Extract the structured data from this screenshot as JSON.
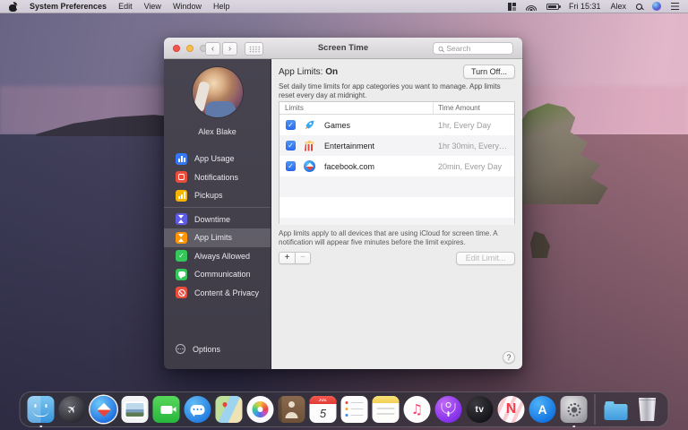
{
  "menu_bar": {
    "app_name": "System Preferences",
    "items": [
      "Edit",
      "View",
      "Window",
      "Help"
    ],
    "status": {
      "time": "Fri 15:31",
      "user": "Alex"
    },
    "icons": [
      "apple-icon",
      "input-source-icon",
      "wifi-icon",
      "battery-icon",
      "spotlight-icon",
      "siri-icon",
      "notification-center-icon"
    ]
  },
  "window": {
    "title": "Screen Time",
    "search_placeholder": "Search",
    "titlebar_icons": [
      "back-icon",
      "forward-icon",
      "grid-view-icon"
    ],
    "sidebar": {
      "user_name": "Alex Blake",
      "items": [
        {
          "label": "App Usage",
          "icon": "bar-chart-icon",
          "color": "#3478f6",
          "selected": false
        },
        {
          "label": "Notifications",
          "icon": "app-badge-icon",
          "color": "#eb4d3d",
          "selected": false
        },
        {
          "label": "Pickups",
          "icon": "pickups-chart-icon",
          "color": "#f7b500",
          "selected": false
        },
        {
          "label": "Downtime",
          "icon": "hourglass-icon",
          "color": "#5e5ce6",
          "selected": false
        },
        {
          "label": "App Limits",
          "icon": "hourglass-icon",
          "color": "#ff9500",
          "selected": true
        },
        {
          "label": "Always Allowed",
          "icon": "checkmark-icon",
          "color": "#34c759",
          "selected": false
        },
        {
          "label": "Communication",
          "icon": "speech-bubble-icon",
          "color": "#34c759",
          "selected": false
        },
        {
          "label": "Content & Privacy",
          "icon": "prohibition-icon",
          "color": "#eb4d3d",
          "selected": false
        }
      ],
      "options_label": "Options"
    },
    "main": {
      "heading_label": "App Limits:",
      "heading_value": "On",
      "turn_off_label": "Turn Off...",
      "description": "Set daily time limits for app categories you want to manage. App limits reset every day at midnight.",
      "table": {
        "columns": [
          "Limits",
          "Time Amount"
        ],
        "rows": [
          {
            "name": "Games",
            "checked": true,
            "icon": "rocket-icon",
            "time": "1hr, Every Day"
          },
          {
            "name": "Entertainment",
            "checked": true,
            "icon": "popcorn-icon",
            "time": "1hr 30min, Every…"
          },
          {
            "name": "facebook.com",
            "checked": true,
            "icon": "safari-compass-icon",
            "time": "20min, Every Day"
          }
        ]
      },
      "note": "App limits apply to all devices that are using iCloud for screen time. A notification will appear five minutes before the limit expires.",
      "edit_limit_label": "Edit Limit..."
    }
  },
  "glyphs": {
    "check": "✓",
    "plus": "+",
    "minus": "−",
    "help": "?",
    "back": "‹",
    "forward": "›",
    "rocket": "✈",
    "music_note": "♫"
  },
  "dock": {
    "apps": [
      "Finder",
      "Launchpad",
      "Safari",
      "Preview",
      "FaceTime",
      "Messages",
      "Maps",
      "Photos",
      "Contacts",
      "Calendar",
      "Reminders",
      "Notes",
      "Music",
      "Podcasts",
      "TV",
      "News",
      "App Store",
      "System Preferences",
      "Downloads",
      "Trash"
    ],
    "calendar_month": "JUL",
    "calendar_day": "5",
    "tv_label": "tv",
    "news_letter": "N",
    "appstore_letter": "A",
    "running_apps": [
      "Finder",
      "System Preferences"
    ]
  },
  "colors": {
    "checkbox_blue": "#2a6cf0",
    "sidebar_bg": "#434049",
    "window_bg": "#ececec",
    "selection_highlight": "rgba(255,255,255,0.16)",
    "dock_bg": "rgba(52,50,60,0.72)"
  }
}
